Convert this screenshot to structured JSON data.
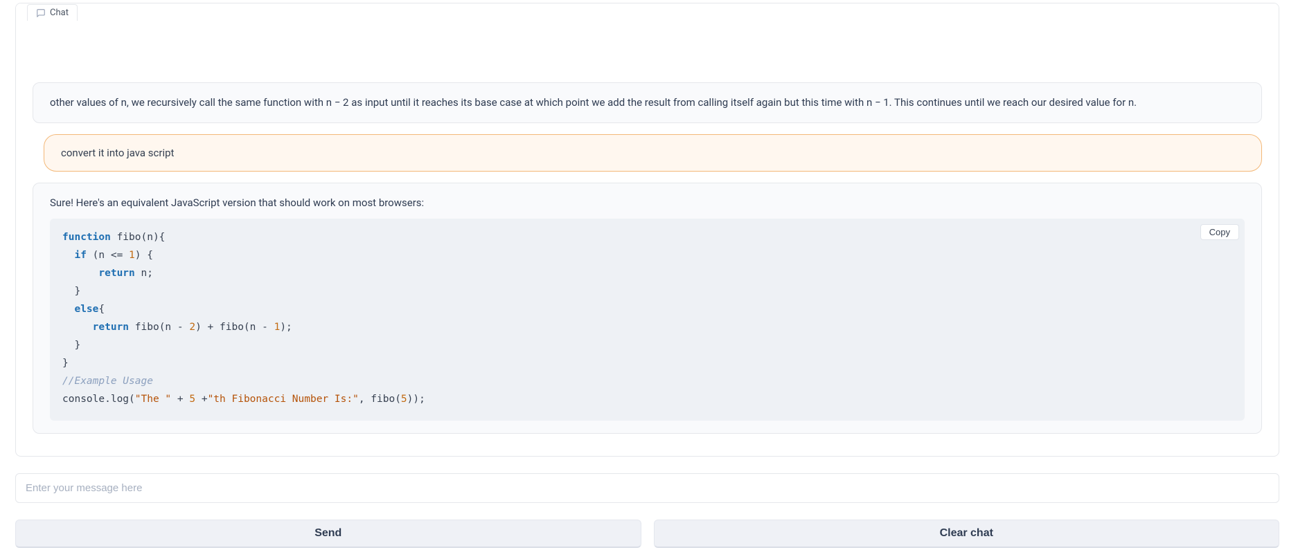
{
  "tab": {
    "label": "Chat"
  },
  "messages": {
    "prev_assistant_tail": "other values of n, we recursively call the same function with n  −  2 as input until it reaches its base case at which point we add the result from calling itself again but this time with n  −  1. This continues until we reach our desired value for n.",
    "user": "convert it into java script",
    "assistant_intro": "Sure! Here's an equivalent JavaScript version that should work on most browsers:",
    "code": {
      "l1_kw": "function",
      "l1_rest": " fibo(n){",
      "l2_kw": "if",
      "l2_mid": " (n <= ",
      "l2_num": "1",
      "l2_end": ") {",
      "l3_kw": "return",
      "l3_rest": " n;",
      "l4": "  }",
      "l5_kw": "else",
      "l5_rest": "{",
      "l6_kw": "return",
      "l6_a": " fibo(n - ",
      "l6_n1": "2",
      "l6_b": ") + fibo(n - ",
      "l6_n2": "1",
      "l6_c": ");",
      "l7": "  }",
      "l8": "}",
      "l9_comment": "//Example Usage",
      "l10_a": "console.log(",
      "l10_s1": "\"The \"",
      "l10_b": " + ",
      "l10_n": "5",
      "l10_c": " +",
      "l10_s2": "\"th Fibonacci Number Is:\"",
      "l10_d": ", fibo(",
      "l10_n2": "5",
      "l10_e": "));"
    },
    "copy_label": "Copy"
  },
  "input": {
    "placeholder": "Enter your message here"
  },
  "buttons": {
    "send": "Send",
    "clear": "Clear chat"
  }
}
